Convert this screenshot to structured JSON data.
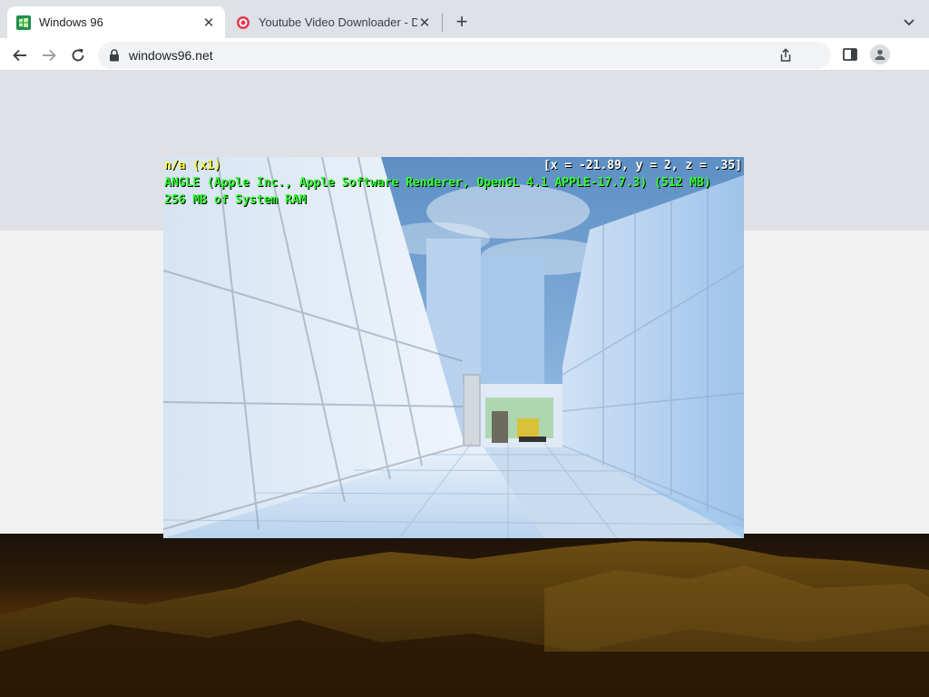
{
  "tabs": [
    {
      "title": "Windows 96",
      "active": true,
      "icon": "windows96-icon"
    },
    {
      "title": "Youtube Video Downloader - D",
      "active": false,
      "icon": "downloader-icon"
    }
  ],
  "toolbar": {
    "url": "windows96.net"
  },
  "game_hud": {
    "fps": "n/a (x1)",
    "coords": "[x = -21.89, y = 2, z = .35]",
    "renderer": "ANGLE (Apple Inc., Apple Software Renderer, OpenGL 4.1 APPLE-17.7.3) (512 MB)",
    "ram": "256 MB of System RAM"
  },
  "colors": {
    "tabstrip": "#dee1e6",
    "hud_yellow": "#ffff33",
    "hud_green": "#33ff33",
    "sky": "#a7c9ea"
  }
}
